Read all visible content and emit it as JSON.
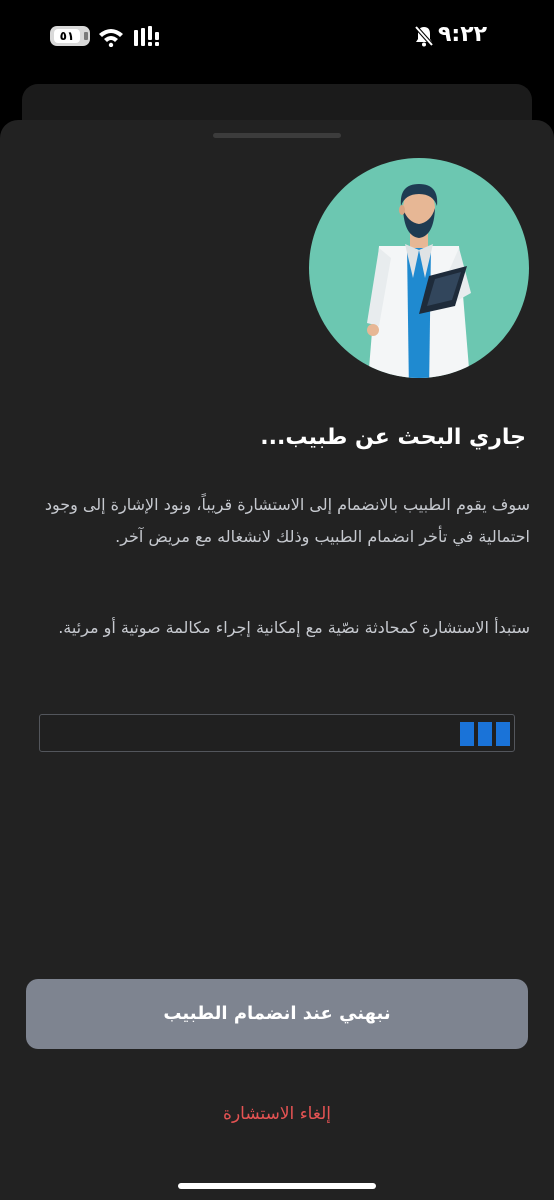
{
  "status_bar": {
    "time": "٩:٢٢",
    "battery_level": "٥١",
    "icons": [
      "battery-icon",
      "wifi-icon",
      "cellular-signal-icon",
      "bell-muted-icon"
    ]
  },
  "search_sheet": {
    "illustration": "doctor-with-clipboard",
    "title": "جاري البحث عن طبيب...",
    "paragraph_1": "سوف يقوم الطبيب بالانضمام إلى الاستشارة قريباً، ونود الإشارة إلى وجود احتمالية في تأخر انضمام الطبيب وذلك لانشغاله مع مريض آخر.",
    "paragraph_2": "ستبدأ الاستشارة كمحادثة نصّية مع إمكانية إجراء مكالمة صوتية أو مرئية.",
    "progress_segments": 3,
    "notify_button_label": "نبهني عند انضمام الطبيب",
    "cancel_label": "إلغاء الاستشارة"
  },
  "colors": {
    "background": "#000000",
    "sheet": "#222222",
    "accent_blue": "#1a73d8",
    "button_gray": "#7e8490",
    "cancel_red": "#e55353",
    "illustration_circle": "#6cc7b1"
  }
}
